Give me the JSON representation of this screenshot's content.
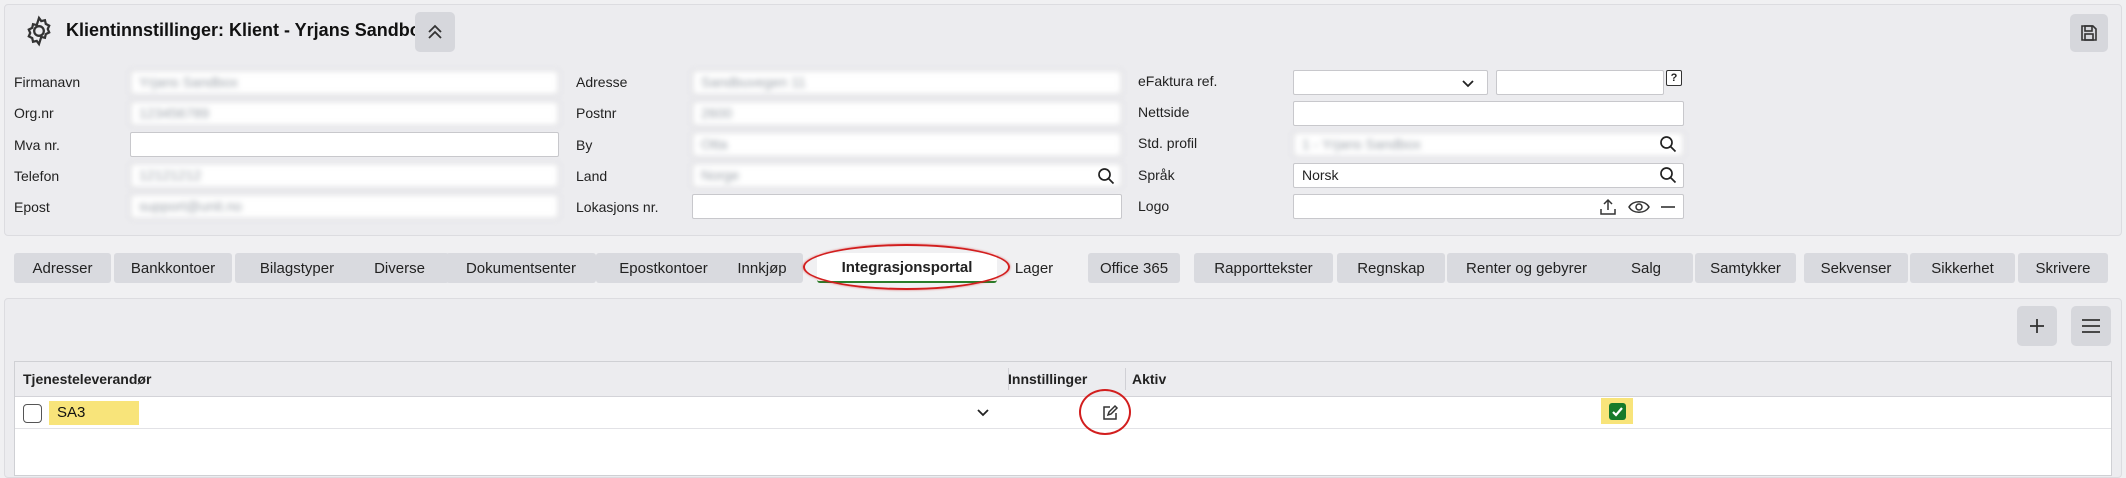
{
  "header": {
    "title": "Klientinnstillinger: Klient - Yrjans Sandbox"
  },
  "form": {
    "col1": [
      {
        "label": "Firmanavn",
        "value": "Yrjans Sandbox"
      },
      {
        "label": "Org.nr",
        "value": "123456789"
      },
      {
        "label": "Mva nr.",
        "value": ""
      },
      {
        "label": "Telefon",
        "value": "12121212"
      },
      {
        "label": "Epost",
        "value": "support@unit.no"
      }
    ],
    "col2": [
      {
        "label": "Adresse",
        "value": "Sandbuvegen 11"
      },
      {
        "label": "Postnr",
        "value": "2600"
      },
      {
        "label": "By",
        "value": "Otta"
      },
      {
        "label": "Land",
        "value": "Norge"
      },
      {
        "label": "Lokasjons nr.",
        "value": ""
      }
    ],
    "col3": [
      {
        "label": "eFaktura ref.",
        "value": ""
      },
      {
        "label": "Nettside",
        "value": ""
      },
      {
        "label": "Std. profil",
        "value": "1 - Yrjans Sandbox"
      },
      {
        "label": "Språk",
        "value": "Norsk"
      },
      {
        "label": "Logo",
        "value": ""
      }
    ],
    "efaktura_extra": "",
    "help_glyph": "?"
  },
  "tabs": [
    {
      "label": "Adresser"
    },
    {
      "label": "Bankkontoer"
    },
    {
      "label": "Bilagstyper"
    },
    {
      "label": "Diverse"
    },
    {
      "label": "Dokumentsenter"
    },
    {
      "label": "Epostkontoer"
    },
    {
      "label": "Innkjøp"
    },
    {
      "label": "Integrasjonsportal",
      "active": true
    },
    {
      "label": "Lager"
    },
    {
      "label": "Office 365"
    },
    {
      "label": "Rapporttekster"
    },
    {
      "label": "Regnskap"
    },
    {
      "label": "Renter og gebyrer"
    },
    {
      "label": "Salg"
    },
    {
      "label": "Samtykker"
    },
    {
      "label": "Sekvenser"
    },
    {
      "label": "Sikkerhet"
    },
    {
      "label": "Skrivere"
    }
  ],
  "grid": {
    "columns": [
      "Tjenesteleverandør",
      "Innstillinger",
      "Aktiv"
    ],
    "rows": [
      {
        "provider": "SA3",
        "aktiv": true
      }
    ]
  },
  "colors": {
    "highlight": "#f8e47a",
    "annotation_red": "#d21e1e",
    "check_green": "#157a2a"
  },
  "icons": [
    "gear-icon",
    "chevrons-up-icon",
    "save-icon",
    "chevron-down-icon",
    "search-icon",
    "upload-icon",
    "eye-icon",
    "minus-icon",
    "plus-icon",
    "menu-icon",
    "edit-icon",
    "checkmark-icon"
  ]
}
